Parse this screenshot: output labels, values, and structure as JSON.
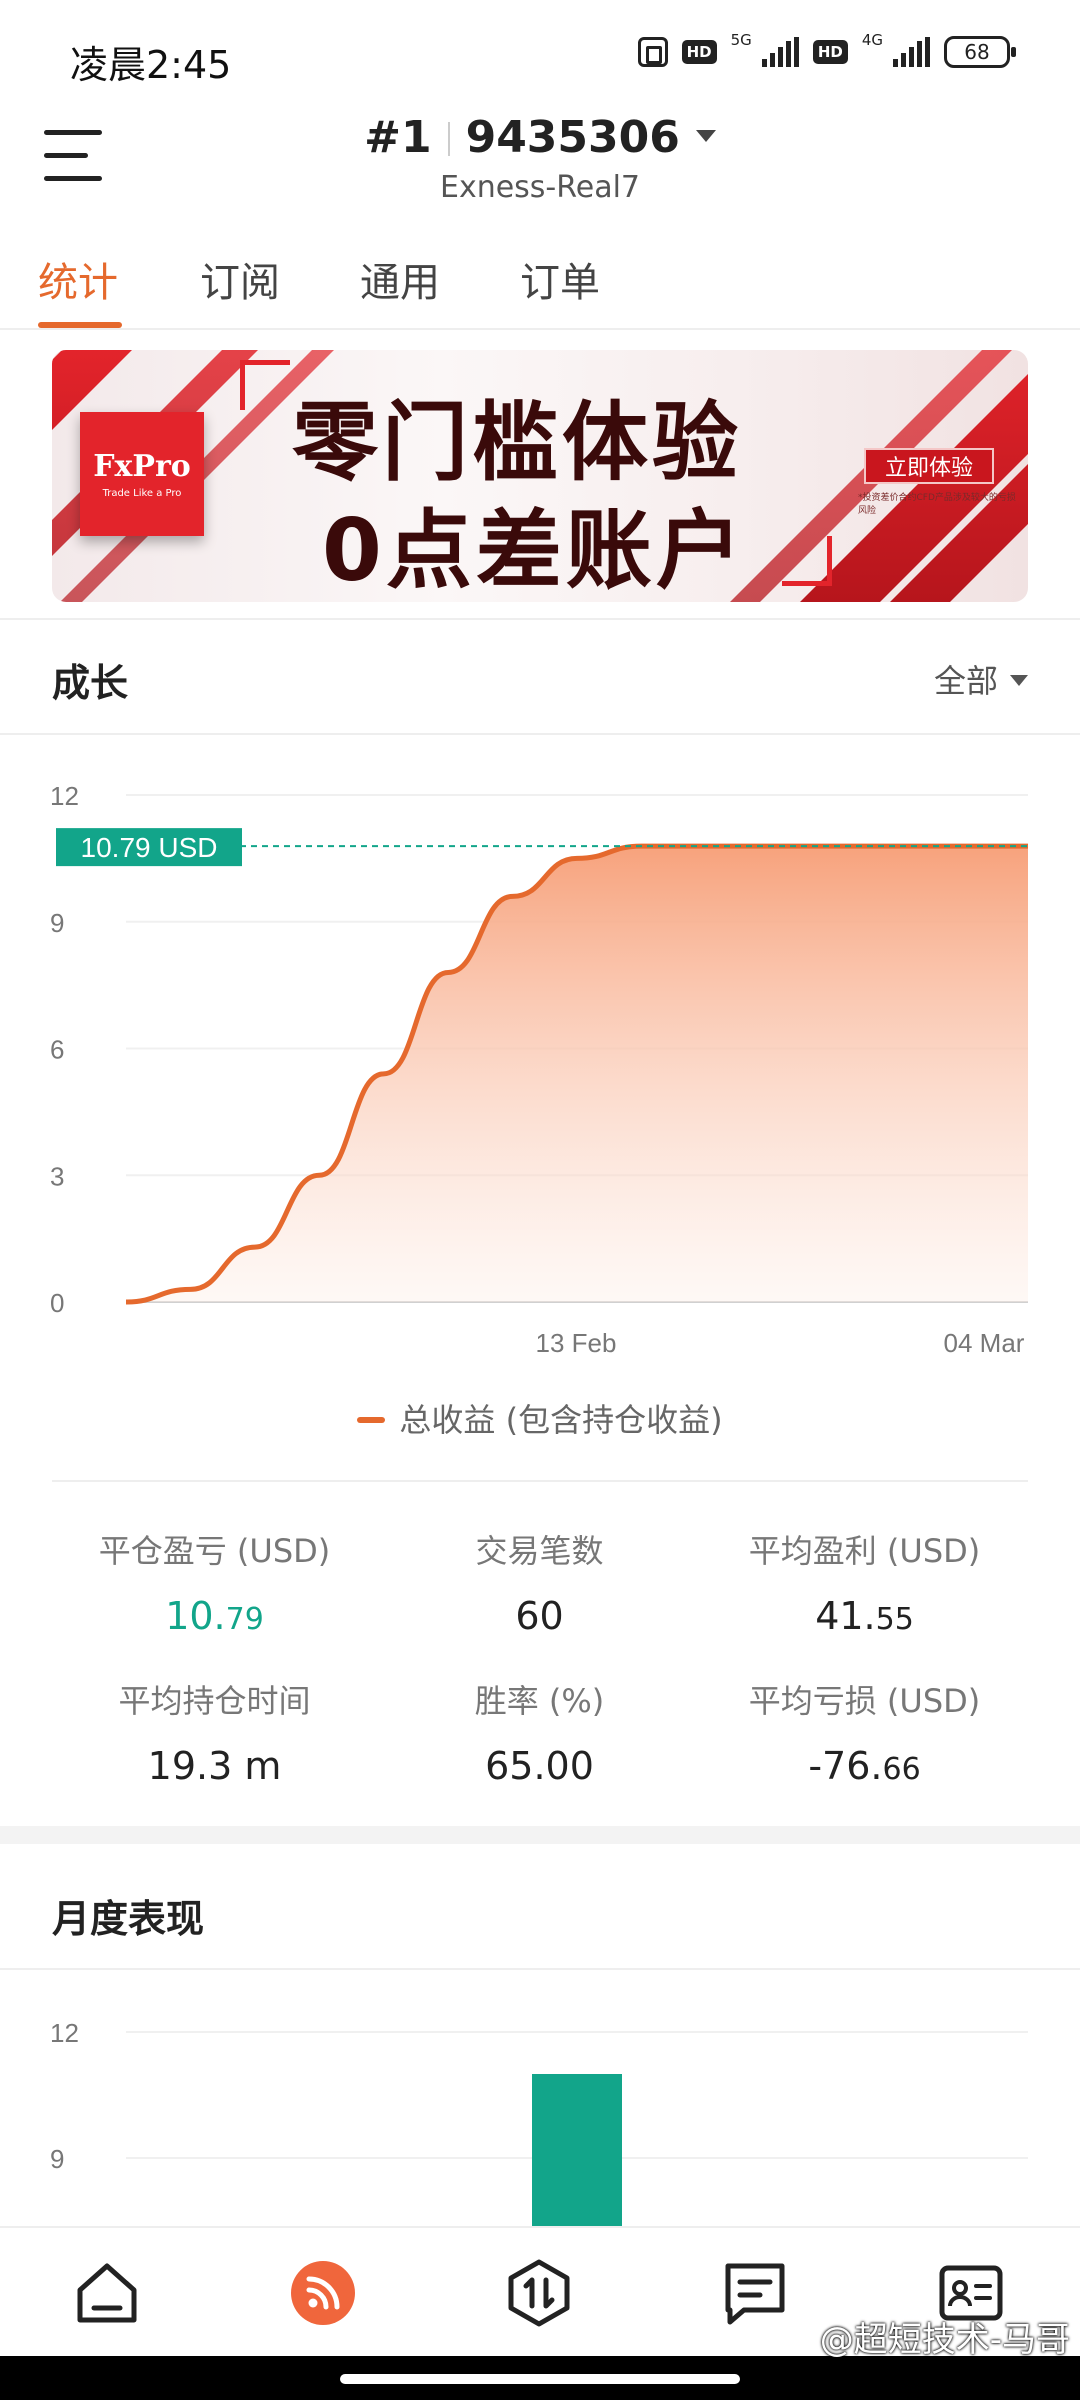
{
  "status_bar": {
    "time": "凌晨2:45",
    "net1": "5G",
    "net2": "4G",
    "hd": "HD",
    "battery": "68"
  },
  "header": {
    "account_prefix": "#1",
    "account_number": "9435306",
    "server": "Exness-Real7"
  },
  "tabs": [
    {
      "label": "统计",
      "active": true
    },
    {
      "label": "订阅",
      "active": false
    },
    {
      "label": "通用",
      "active": false
    },
    {
      "label": "订单",
      "active": false
    }
  ],
  "banner": {
    "logo": "FxPro",
    "logo_tagline": "Trade Like a Pro",
    "line1": "零门槛体验",
    "line2": "0点差账户",
    "button": "立即体验",
    "note": "*投资差价合约CFD产品涉及较大的亏损风险"
  },
  "growth": {
    "title": "成长",
    "filter": "全部",
    "current_label": "10.79 USD",
    "legend": "总收益 (包含持仓收益)"
  },
  "chart_data": {
    "type": "area",
    "ylim": [
      0,
      12
    ],
    "y_ticks": [
      "12",
      "9",
      "6",
      "3",
      "0"
    ],
    "x_ticks": [
      "13 Feb",
      "04 Mar"
    ],
    "series": [
      {
        "name": "总收益 (包含持仓收益)",
        "color": "#e5692d",
        "values": [
          0,
          0.3,
          1.3,
          3.0,
          5.4,
          7.8,
          9.6,
          10.5,
          10.79,
          10.79,
          10.79,
          10.79,
          10.79,
          10.79,
          10.79
        ]
      }
    ],
    "last_value": 10.79,
    "last_value_color": "#12a58a"
  },
  "stats": {
    "closed_pl": {
      "label": "平仓盈亏 (USD)",
      "int": "10.",
      "dec": "79"
    },
    "trades": {
      "label": "交易笔数",
      "value": "60"
    },
    "avg_profit": {
      "label": "平均盈利 (USD)",
      "int": "41.",
      "dec": "55"
    },
    "avg_hold": {
      "label": "平均持仓时间",
      "value": "19.3 m"
    },
    "win_rate": {
      "label": "胜率 (%)",
      "value": "65.00"
    },
    "avg_loss": {
      "label": "平均亏损 (USD)",
      "int": "-76.",
      "dec": "66"
    }
  },
  "monthly": {
    "title": "月度表现",
    "y_ticks": [
      "12",
      "9"
    ],
    "bar_value": 11,
    "bar_color": "#12a58a"
  },
  "bottom_nav": [
    {
      "icon": "home-icon"
    },
    {
      "icon": "feed-icon",
      "active": true
    },
    {
      "icon": "trade-icon"
    },
    {
      "icon": "chat-icon"
    },
    {
      "icon": "profile-card-icon"
    }
  ],
  "watermark": "@超短技术-马哥"
}
